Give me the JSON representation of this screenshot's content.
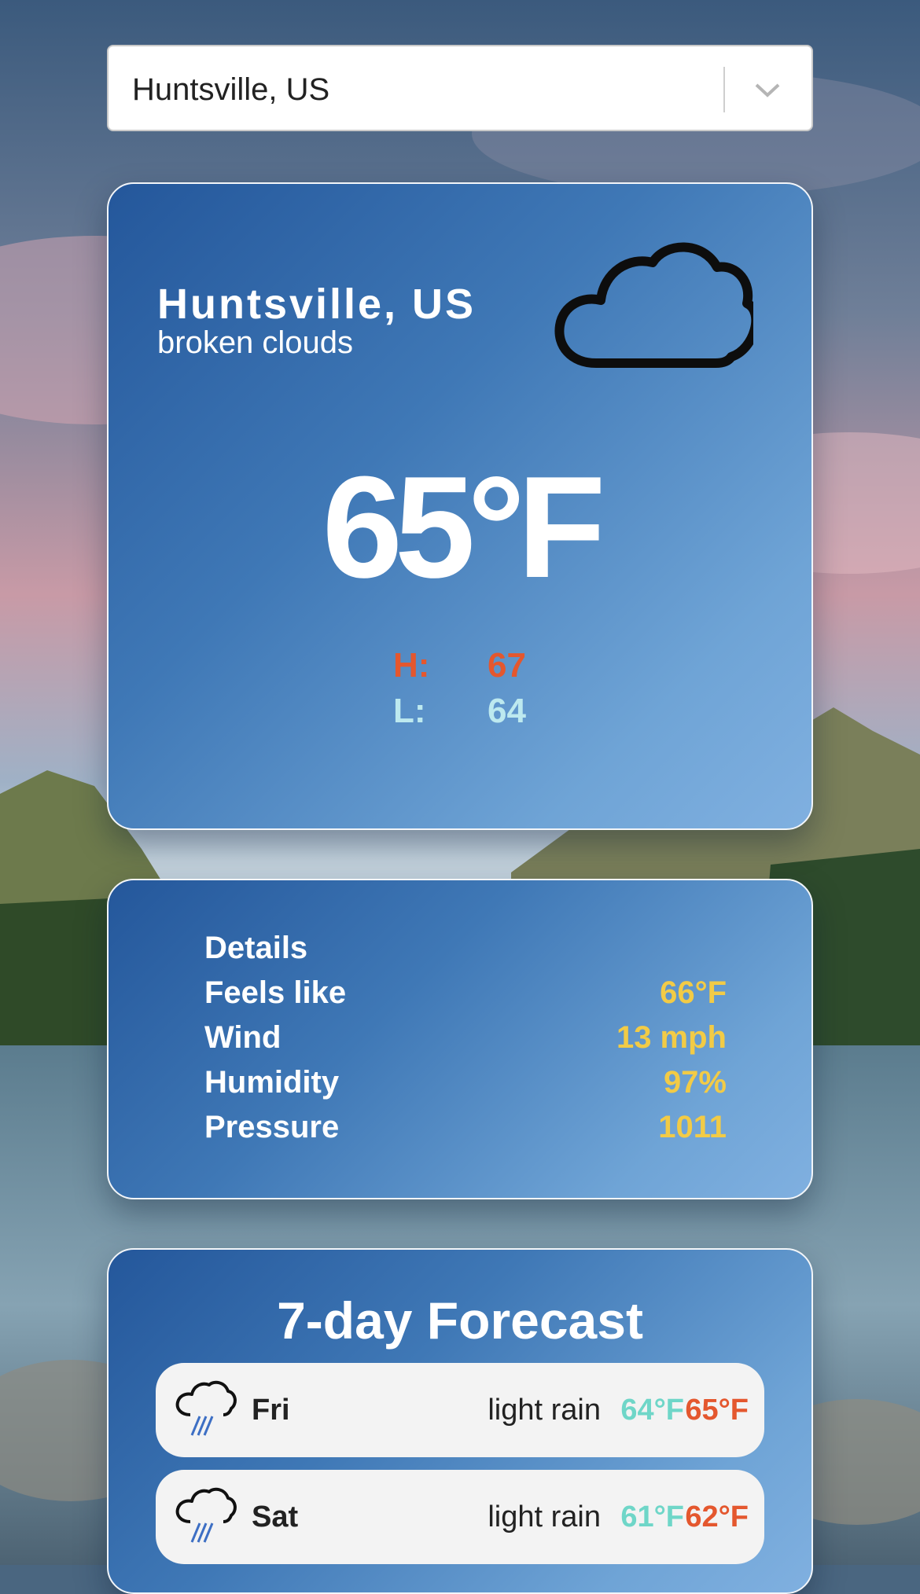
{
  "search": {
    "selected": "Huntsville, US"
  },
  "current": {
    "city": "Huntsville, US",
    "description": "broken clouds",
    "icon": "cloud-icon",
    "temperature": "65°F",
    "high_label": "H:",
    "high": "67",
    "low_label": "L:",
    "low": "64"
  },
  "details": {
    "title": "Details",
    "rows": [
      {
        "label": "Feels like",
        "value": "66°F"
      },
      {
        "label": "Wind",
        "value": "13 mph"
      },
      {
        "label": "Humidity",
        "value": "97%"
      },
      {
        "label": "Pressure",
        "value": "1011"
      }
    ]
  },
  "forecast": {
    "title": "7-day Forecast",
    "days": [
      {
        "day": "Fri",
        "description": "light rain",
        "low": "64°F",
        "high": "65°F",
        "icon": "rain-cloud-icon"
      },
      {
        "day": "Sat",
        "description": "light rain",
        "low": "61°F",
        "high": "62°F",
        "icon": "rain-cloud-icon"
      }
    ]
  },
  "colors": {
    "high": "#e4572e",
    "low_forecast": "#6fd6c8",
    "low_current": "#bde9ef",
    "detail_value": "#f2cb46",
    "card_gradient_start": "#24579b",
    "card_gradient_end": "#80b0e0"
  }
}
